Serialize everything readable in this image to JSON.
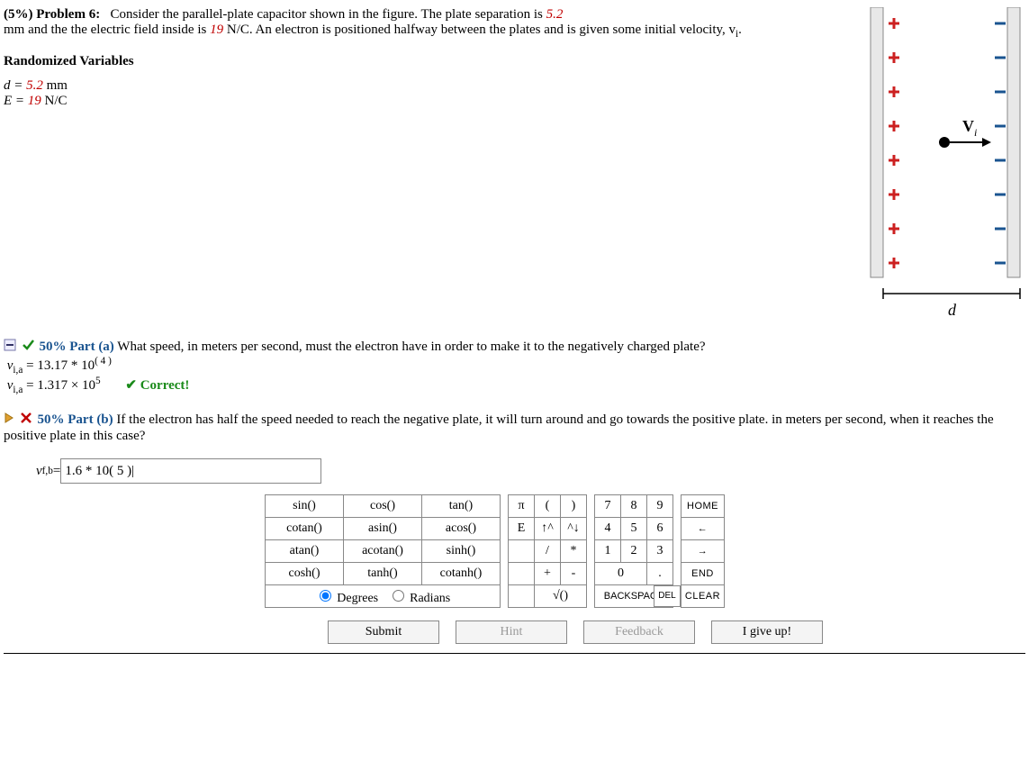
{
  "problem": {
    "weight_label": "(5%)",
    "title": "Problem 6:",
    "body_line1": "Consider the parallel-plate capacitor shown in the figure. The plate separation is ",
    "d_value": "5.2",
    "body_line2": "mm and the the electric field inside is ",
    "E_value": "19",
    "body_line3": " N/C. An electron is positioned halfway between the plates and is given some initial velocity, v",
    "vi_sub": "i",
    "body_line4": "."
  },
  "rand_vars": {
    "heading": "Randomized Variables",
    "d_line_prefix": "d = ",
    "d_line_value": "5.2",
    "d_line_unit": " mm",
    "E_line_prefix": "E = ",
    "E_line_value": "19",
    "E_line_unit": " N/C"
  },
  "figure": {
    "vi_label": "V",
    "vi_sub": "i",
    "d_label": "d"
  },
  "part_a": {
    "weight": "50% Part (a)",
    "text": "  What speed, in meters per second, must the electron have in order to make it to the negatively charged plate?",
    "entered_prefix": "v",
    "entered_sub": "i,a",
    "entered_eq": " = 13.17 * 10",
    "entered_exp": "( 4 )",
    "eval_prefix": "v",
    "eval_sub": "i,a",
    "eval_eq": " = 1.317 × 10",
    "eval_exp": "5",
    "correct": "✔ Correct!"
  },
  "part_b": {
    "weight": "50% Part (b)",
    "text": "  If the electron has half the speed needed to reach the negative plate, it will turn around and go towards the positive plate. in meters per second, when it reaches the positive plate in this case?",
    "var_prefix": "v",
    "var_sub": "f,b",
    "var_eq": " = ",
    "input_value": "1.6 * 10( 5 )|"
  },
  "calc": {
    "fn": [
      [
        "sin()",
        "cos()",
        "tan()"
      ],
      [
        "cotan()",
        "asin()",
        "acos()"
      ],
      [
        "atan()",
        "acotan()",
        "sinh()"
      ],
      [
        "cosh()",
        "tanh()",
        "cotanh()"
      ]
    ],
    "mode": {
      "deg": "Degrees",
      "rad": "Radians"
    },
    "ops": [
      [
        "π",
        "(",
        ")"
      ],
      [
        "E",
        "↑^",
        "^↓"
      ],
      [
        "",
        "/",
        "*"
      ],
      [
        "",
        "+",
        "-"
      ],
      [
        "",
        "√()",
        ""
      ]
    ],
    "nums": [
      [
        "7",
        "8",
        "9"
      ],
      [
        "4",
        "5",
        "6"
      ],
      [
        "1",
        "2",
        "3"
      ]
    ],
    "zero": "0",
    "dot": ".",
    "backspace": "BACKSPACE",
    "del": "DEL",
    "ctrl": [
      "HOME",
      "←",
      "→",
      "END",
      "CLEAR"
    ]
  },
  "buttons": {
    "submit": "Submit",
    "hint": "Hint",
    "feedback": "Feedback",
    "giveup": "I give up!"
  }
}
